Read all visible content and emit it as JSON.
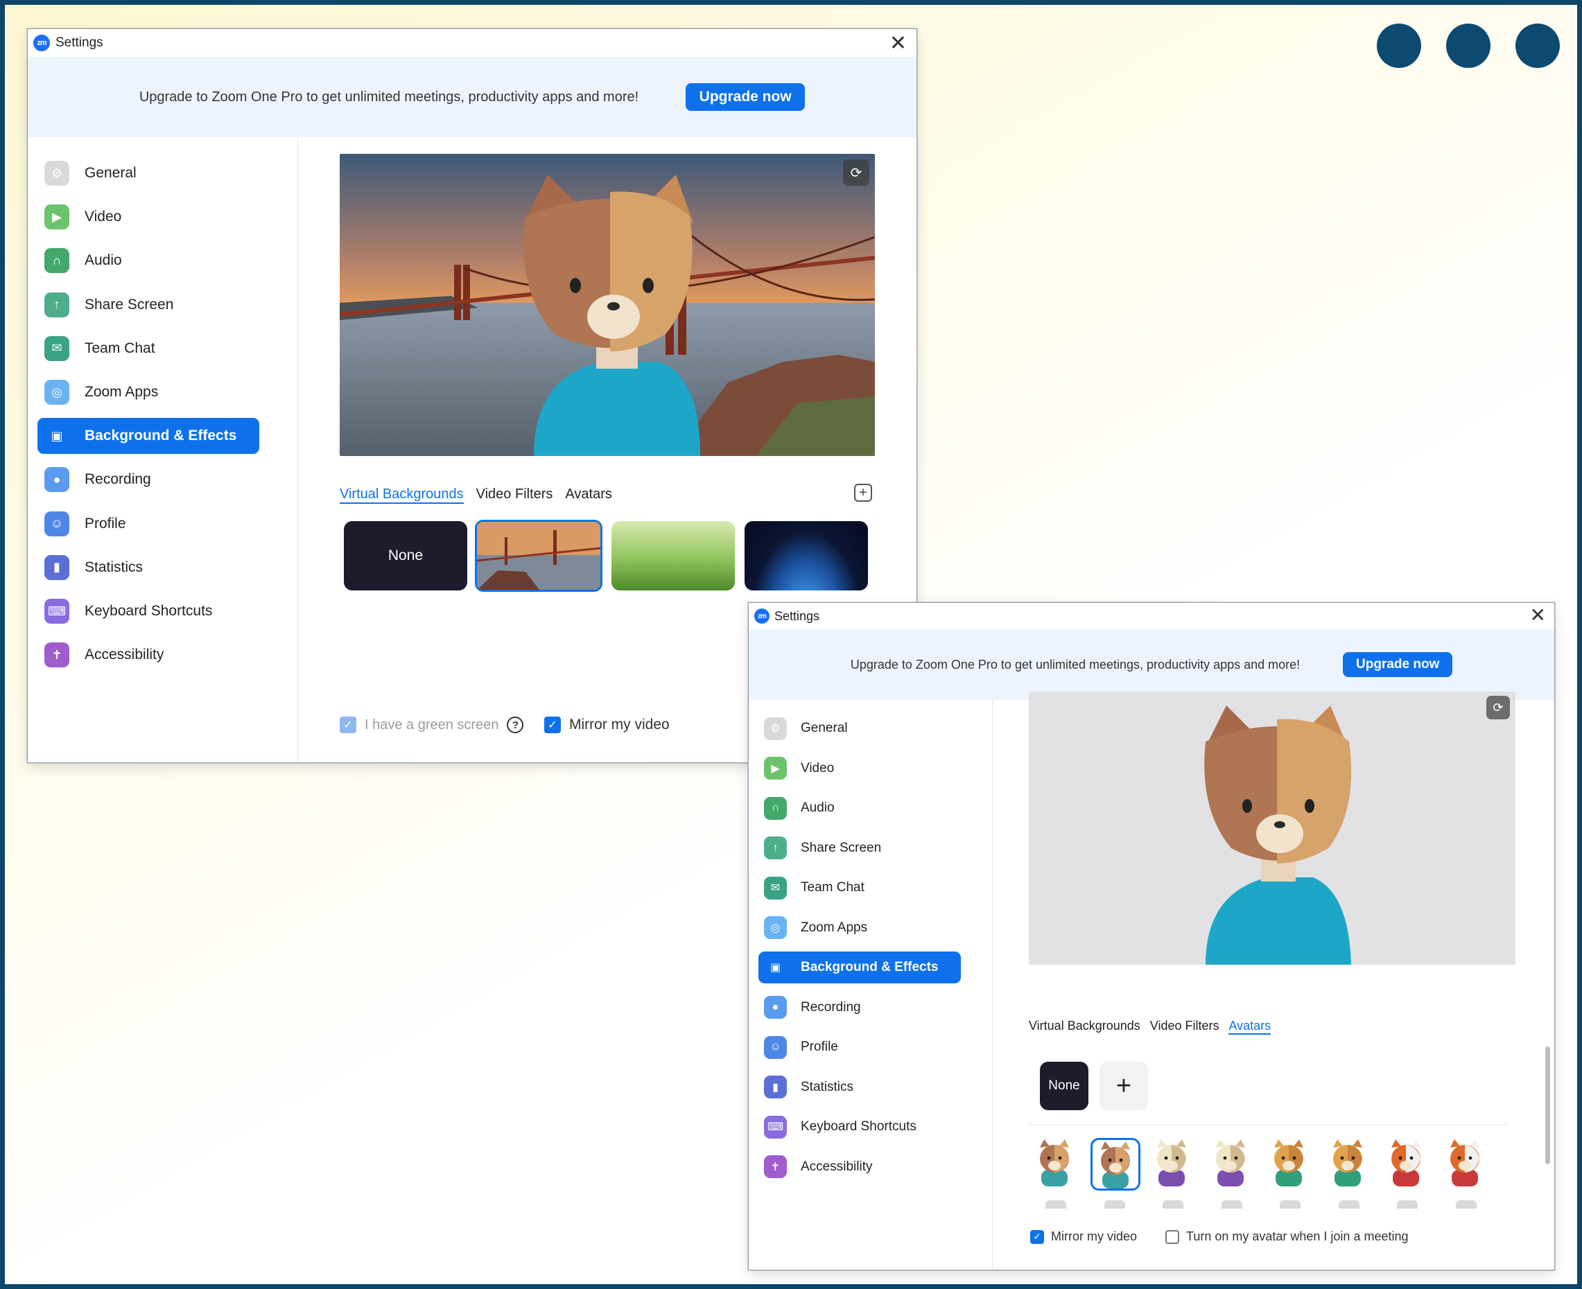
{
  "colors": {
    "frame": "#0d4669",
    "accent": "#0e71eb",
    "banner_bg": "#eef4fd"
  },
  "window_1": {
    "title": "Settings",
    "logo": "zm",
    "close_glyph": "✕",
    "banner": {
      "message": "Upgrade to Zoom One Pro to get unlimited meetings, productivity apps and more!",
      "button": "Upgrade now"
    },
    "nav": [
      {
        "label": "General",
        "icon": "gear-icon"
      },
      {
        "label": "Video",
        "icon": "video-icon"
      },
      {
        "label": "Audio",
        "icon": "headphones-icon"
      },
      {
        "label": "Share Screen",
        "icon": "share-screen-icon"
      },
      {
        "label": "Team Chat",
        "icon": "chat-icon"
      },
      {
        "label": "Zoom Apps",
        "icon": "apps-icon"
      },
      {
        "label": "Background & Effects",
        "icon": "background-icon",
        "active": true
      },
      {
        "label": "Recording",
        "icon": "record-icon"
      },
      {
        "label": "Profile",
        "icon": "profile-icon"
      },
      {
        "label": "Statistics",
        "icon": "statistics-icon"
      },
      {
        "label": "Keyboard Shortcuts",
        "icon": "keyboard-icon"
      },
      {
        "label": "Accessibility",
        "icon": "accessibility-icon"
      }
    ],
    "tabs": [
      "Virtual Backgrounds",
      "Video Filters",
      "Avatars"
    ],
    "active_tab": "Virtual Backgrounds",
    "backgrounds": [
      "None",
      "golden-gate",
      "grass",
      "earth"
    ],
    "selected_background": "golden-gate",
    "none_label": "None",
    "green_screen_label": "I have a green screen",
    "green_screen_checked": true,
    "mirror_label": "Mirror my video",
    "mirror_checked": true
  },
  "window_2": {
    "title": "Settings",
    "logo": "zm",
    "close_glyph": "✕",
    "banner": {
      "message": "Upgrade to Zoom One Pro to get unlimited meetings, productivity apps and more!",
      "button": "Upgrade now"
    },
    "nav": [
      {
        "label": "General",
        "icon": "gear-icon"
      },
      {
        "label": "Video",
        "icon": "video-icon"
      },
      {
        "label": "Audio",
        "icon": "headphones-icon"
      },
      {
        "label": "Share Screen",
        "icon": "share-screen-icon"
      },
      {
        "label": "Team Chat",
        "icon": "chat-icon"
      },
      {
        "label": "Zoom Apps",
        "icon": "apps-icon"
      },
      {
        "label": "Background & Effects",
        "icon": "background-icon",
        "active": true
      },
      {
        "label": "Recording",
        "icon": "record-icon"
      },
      {
        "label": "Profile",
        "icon": "profile-icon"
      },
      {
        "label": "Statistics",
        "icon": "statistics-icon"
      },
      {
        "label": "Keyboard Shortcuts",
        "icon": "keyboard-icon"
      },
      {
        "label": "Accessibility",
        "icon": "accessibility-icon"
      }
    ],
    "tabs": [
      "Virtual Backgrounds",
      "Video Filters",
      "Avatars"
    ],
    "active_tab": "Avatars",
    "none_label": "None",
    "add_glyph": "+",
    "avatars": [
      "cat",
      "cat",
      "cow",
      "cow",
      "dog",
      "dog",
      "fox",
      "fox"
    ],
    "selected_avatar_index": 1,
    "mirror_label": "Mirror my video",
    "mirror_checked": true,
    "avatar_join_label": "Turn on my avatar when I join a meeting",
    "avatar_join_checked": false
  }
}
